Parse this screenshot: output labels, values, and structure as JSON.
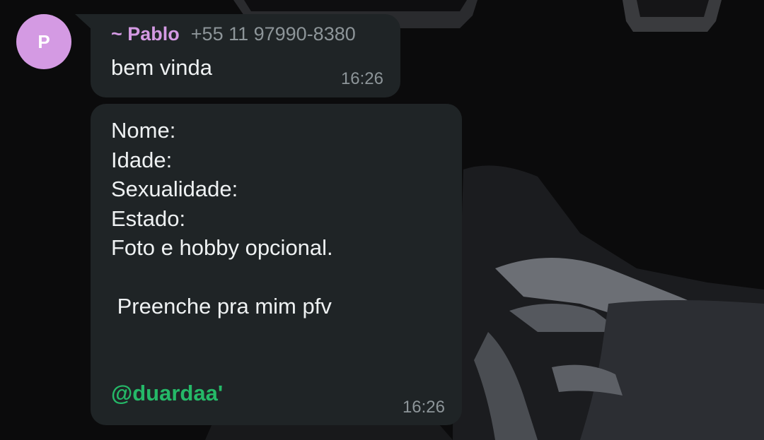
{
  "avatar": {
    "letter": "P",
    "color": "#d49ae3"
  },
  "messages": [
    {
      "sender_name": "~ Pablo",
      "sender_phone": "+55 11 97990-8380",
      "text": "bem vinda",
      "time": "16:26"
    },
    {
      "lines": [
        "Nome:",
        "Idade:",
        "Sexualidade:",
        "Estado:",
        "Foto e hobby opcional.",
        "",
        " Preenche pra mim pfv"
      ],
      "mention": "@duardaa'",
      "time": "16:26"
    }
  ],
  "colors": {
    "bubble": "#1f2426",
    "sender_name": "#d49ae3",
    "mention": "#25b968",
    "meta_text": "#8d9599"
  }
}
